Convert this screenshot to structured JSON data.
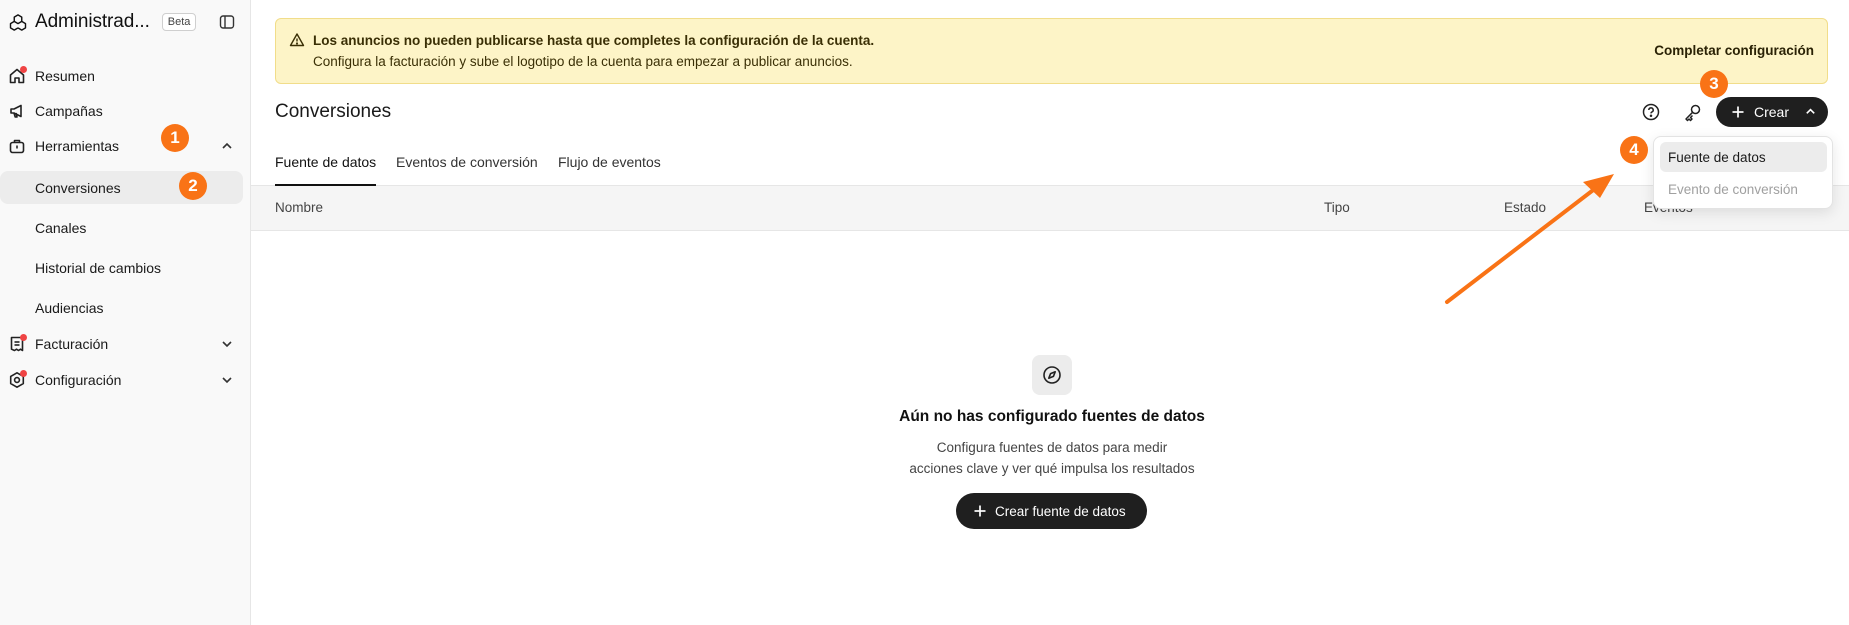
{
  "sidebar": {
    "brand": "Administrad...",
    "beta": "Beta",
    "items": [
      {
        "label": "Resumen"
      },
      {
        "label": "Campañas"
      },
      {
        "label": "Herramientas"
      },
      {
        "label": "Facturación"
      },
      {
        "label": "Configuración"
      }
    ],
    "sub_items": [
      {
        "label": "Conversiones"
      },
      {
        "label": "Canales"
      },
      {
        "label": "Historial de cambios"
      },
      {
        "label": "Audiencias"
      }
    ]
  },
  "alert": {
    "title": "Los anuncios no pueden publicarse hasta que completes la configuración de la cuenta.",
    "description": "Configura la facturación y sube el logotipo de la cuenta para empezar a publicar anuncios.",
    "action": "Completar configuración"
  },
  "header": {
    "title": "Conversiones",
    "create_label": "Crear"
  },
  "tabs": [
    {
      "label": "Fuente de datos"
    },
    {
      "label": "Eventos de conversión"
    },
    {
      "label": "Flujo de eventos"
    }
  ],
  "table": {
    "columns": [
      "Nombre",
      "Tipo",
      "Estado",
      "Eventos"
    ]
  },
  "empty_state": {
    "title": "Aún no has configurado fuentes de datos",
    "line1": "Configura fuentes de datos para medir",
    "line2": "acciones clave y ver qué impulsa los resultados",
    "button": "Crear fuente de datos"
  },
  "dropdown": {
    "items": [
      "Fuente de datos",
      "Evento de conversión"
    ]
  },
  "annotations": {
    "steps": [
      "1",
      "2",
      "3",
      "4"
    ],
    "accent": "#f97316"
  },
  "icons": [
    "openai-logo-icon",
    "sidebar-toggle-icon",
    "home-icon",
    "megaphone-icon",
    "toolbox-icon",
    "invoice-icon",
    "settings-icon",
    "chevron-up-icon",
    "chevron-down-icon",
    "warning-icon",
    "help-icon",
    "key-icon",
    "plus-icon",
    "compass-icon"
  ]
}
